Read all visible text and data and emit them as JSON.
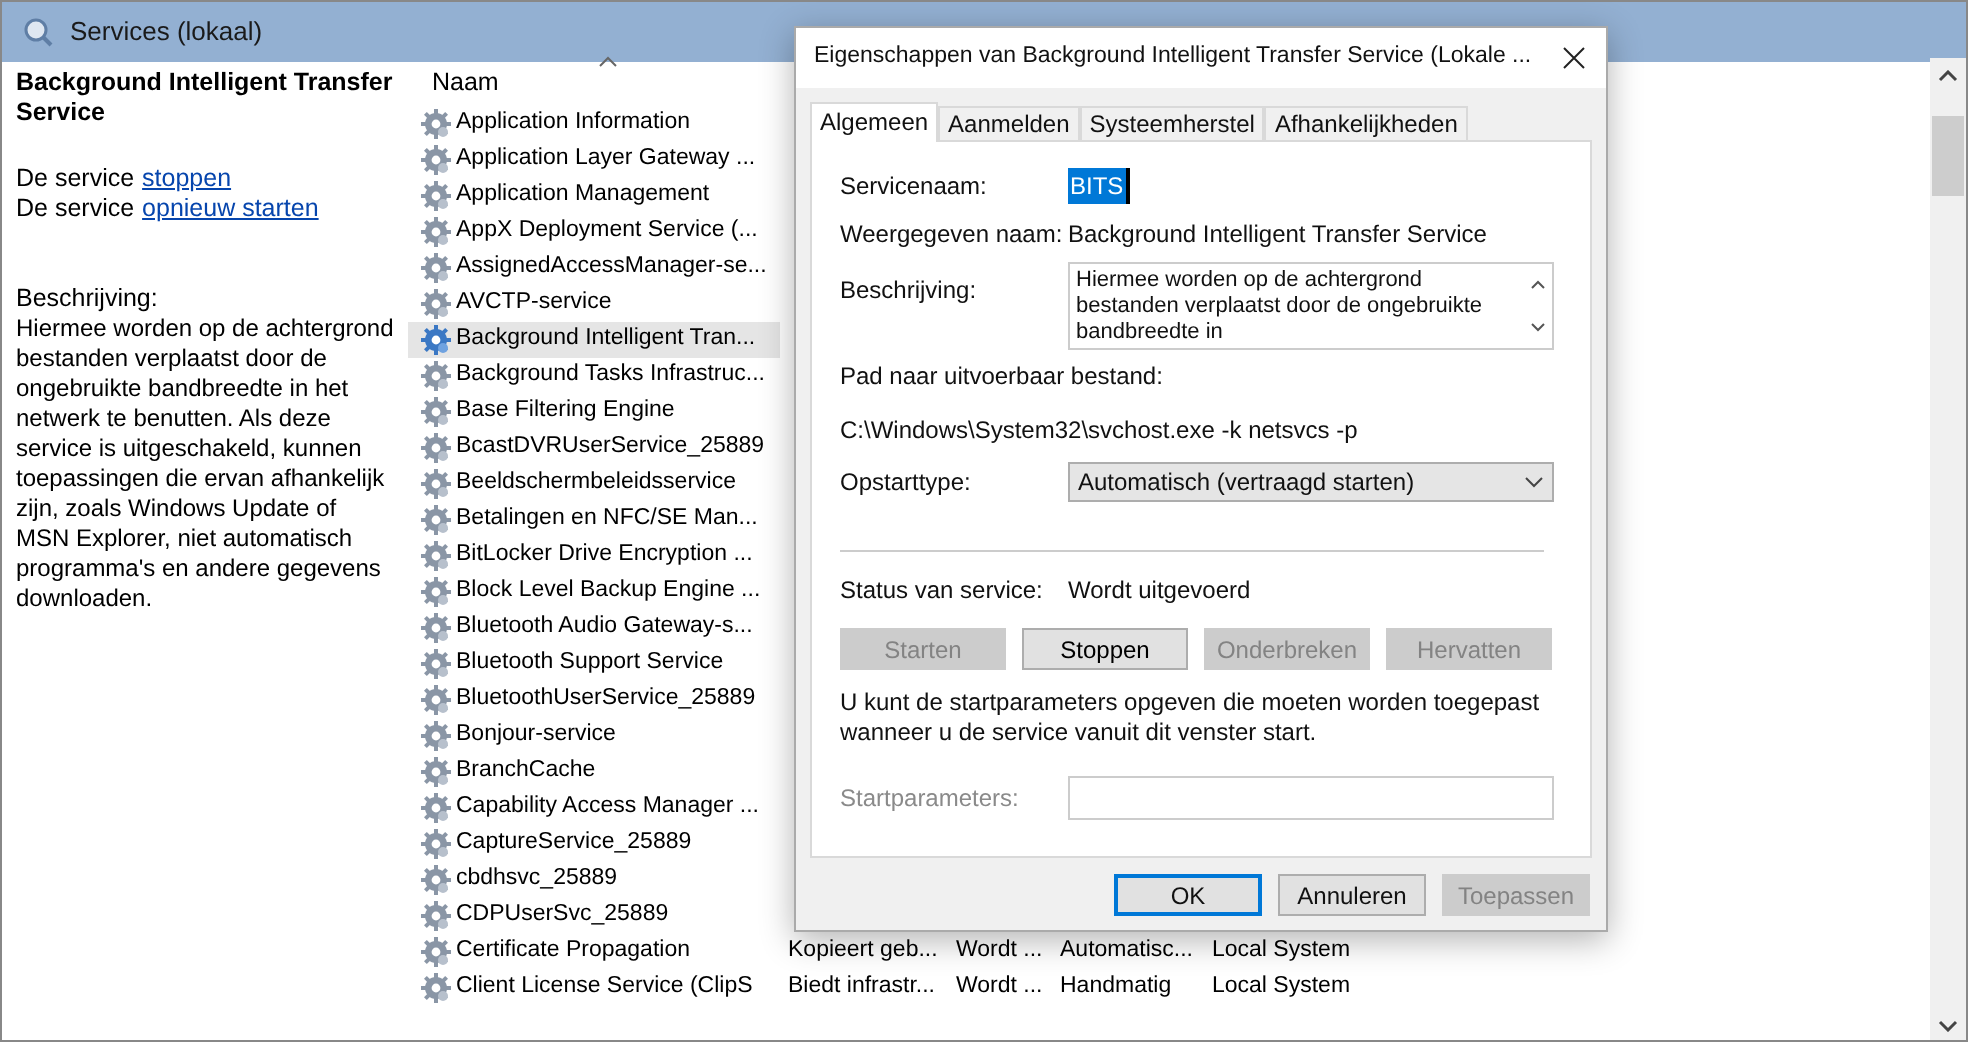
{
  "window": {
    "title": "Services (lokaal)"
  },
  "details": {
    "title": "Background Intelligent Transfer Service",
    "actions": [
      {
        "prefix": "De service",
        "link": "stoppen"
      },
      {
        "prefix": "De service",
        "link": "opnieuw starten"
      }
    ],
    "description_label": "Beschrijving:",
    "description": "Hiermee worden op de achtergrond bestanden verplaatst door de ongebruikte bandbreedte in het netwerk te benutten. Als deze service is uitgeschakeld, kunnen toepassingen die ervan afhankelijk zijn, zoals Windows Update of MSN Explorer, niet automatisch programma's en andere gegevens downloaden."
  },
  "table": {
    "columns": [
      "Naam"
    ],
    "rows": [
      {
        "name": "Application Information",
        "selected": false
      },
      {
        "name": "Application Layer Gateway ...",
        "selected": false
      },
      {
        "name": "Application Management",
        "selected": false
      },
      {
        "name": "AppX Deployment Service (...",
        "selected": false
      },
      {
        "name": "AssignedAccessManager-se...",
        "selected": false
      },
      {
        "name": "AVCTP-service",
        "selected": false
      },
      {
        "name": "Background Intelligent Tran...",
        "selected": true
      },
      {
        "name": "Background Tasks Infrastruc...",
        "selected": false
      },
      {
        "name": "Base Filtering Engine",
        "selected": false
      },
      {
        "name": "BcastDVRUserService_25889",
        "selected": false
      },
      {
        "name": "Beeldschermbeleidsservice",
        "selected": false
      },
      {
        "name": "Betalingen en NFC/SE Man...",
        "selected": false
      },
      {
        "name": "BitLocker Drive Encryption ...",
        "selected": false
      },
      {
        "name": "Block Level Backup Engine ...",
        "selected": false
      },
      {
        "name": "Bluetooth Audio Gateway-s...",
        "selected": false
      },
      {
        "name": "Bluetooth Support Service",
        "selected": false
      },
      {
        "name": "BluetoothUserService_25889",
        "selected": false
      },
      {
        "name": "Bonjour-service",
        "selected": false
      },
      {
        "name": "BranchCache",
        "selected": false
      },
      {
        "name": "Capability Access Manager ...",
        "selected": false
      },
      {
        "name": "CaptureService_25889",
        "selected": false
      },
      {
        "name": "cbdhsvc_25889",
        "selected": false
      },
      {
        "name": "CDPUserSvc_25889",
        "selected": false
      },
      {
        "name": "Certificate Propagation",
        "selected": false,
        "cells": [
          "Kopieert geb...",
          "Wordt ...",
          "Automatisc...",
          "Local System"
        ]
      },
      {
        "name": "Client License Service (ClipS",
        "selected": false,
        "cells": [
          "Biedt infrastr...",
          "Wordt ...",
          "Handmatig",
          "Local System"
        ]
      }
    ]
  },
  "dialog": {
    "title": "Eigenschappen van Background Intelligent Transfer Service (Lokale ...",
    "tabs": [
      {
        "label": "Algemeen",
        "selected": true
      },
      {
        "label": "Aanmelden",
        "selected": false
      },
      {
        "label": "Systeemherstel",
        "selected": false
      },
      {
        "label": "Afhankelijkheden",
        "selected": false
      }
    ],
    "service_name_label": "Servicenaam:",
    "service_name": "BITS",
    "display_name_label": "Weergegeven naam:",
    "display_name": "Background Intelligent Transfer Service",
    "description_label": "Beschrijving:",
    "description": "Hiermee worden op de achtergrond bestanden verplaatst door de ongebruikte bandbreedte in",
    "path_label": "Pad naar uitvoerbaar bestand:",
    "path": "C:\\Windows\\System32\\svchost.exe -k netsvcs -p",
    "startup_label": "Opstarttype:",
    "startup_type": "Automatisch (vertraagd starten)",
    "status_label": "Status van service:",
    "status": "Wordt uitgevoerd",
    "service_buttons": [
      {
        "label": "Starten",
        "disabled": true
      },
      {
        "label": "Stoppen",
        "disabled": false
      },
      {
        "label": "Onderbreken",
        "disabled": true
      },
      {
        "label": "Hervatten",
        "disabled": true
      }
    ],
    "hint": "U kunt de startparameters opgeven die moeten worden toegepast wanneer u de service vanuit dit venster start.",
    "params_label": "Startparameters:",
    "params_disabled": true,
    "buttons": [
      {
        "label": "OK",
        "disabled": false
      },
      {
        "label": "Annuleren",
        "disabled": false
      },
      {
        "label": "Toepassen",
        "disabled": true
      }
    ]
  }
}
